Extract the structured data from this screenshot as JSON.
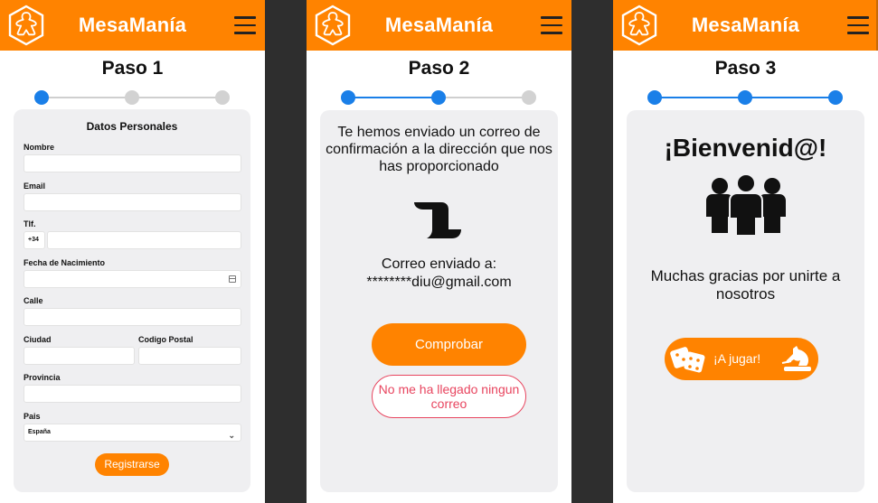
{
  "app": {
    "brand": "MesaManía",
    "accent_color": "#ff8300",
    "step_active_color": "#1a7fe8",
    "error_color": "#e8455f",
    "logo_icon": "meeple-logo-icon",
    "menu_icon": "hamburger-menu-icon"
  },
  "step1": {
    "title": "Paso 1",
    "progress": {
      "current": 1,
      "total": 3
    },
    "form": {
      "title": "Datos Personales",
      "labels": {
        "nombre": "Nombre",
        "email": "Email",
        "tlf": "Tlf.",
        "prefix": "+34",
        "fecha": "Fecha de Nacimiento",
        "calle": "Calle",
        "ciudad": "Ciudad",
        "cp": "Codigo Postal",
        "provincia": "Provincia",
        "pais": "Pais"
      },
      "pais_selected": "España",
      "submit_label": "Registrarse"
    }
  },
  "step2": {
    "title": "Paso 2",
    "progress": {
      "current": 2,
      "total": 3
    },
    "message": "Te hemos enviado un correo de confirmación a la dirección que nos has proporcionado",
    "sent_label": "Correo enviado a:",
    "masked_email": "********diu@gmail.com",
    "check_button": "Comprobar",
    "no_mail_button": "No me ha llegado ningun correo",
    "icon": "scroll-icon"
  },
  "step3": {
    "title": "Paso 3",
    "progress": {
      "current": 3,
      "total": 3
    },
    "welcome": "¡Bienvenid@!",
    "thanks": "Muchas gracias por unirte a nosotros",
    "play_button": "¡A jugar!",
    "icons": [
      "group-people-icon",
      "dice-icon",
      "horse-chess-icon"
    ]
  }
}
